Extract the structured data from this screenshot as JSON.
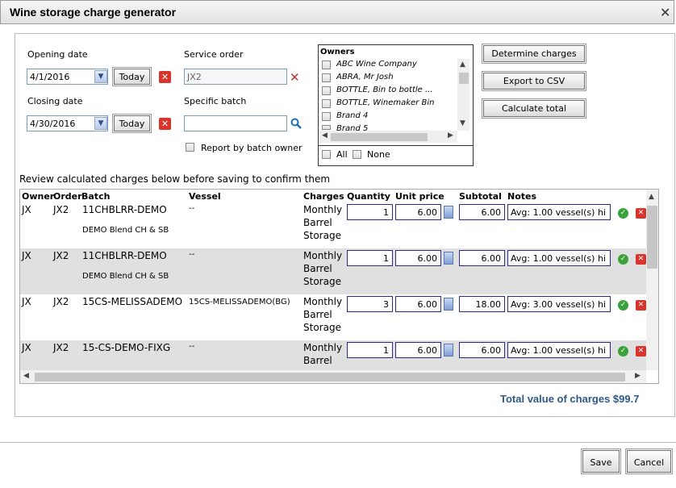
{
  "window": {
    "title": "Wine storage charge generator",
    "close": "✕"
  },
  "filters": {
    "opening_label": "Opening date",
    "opening_value": "4/1/2016",
    "closing_label": "Closing date",
    "closing_value": "4/30/2016",
    "today_label": "Today",
    "service_order_label": "Service order",
    "service_order_value": "JX2",
    "specific_batch_label": "Specific batch",
    "specific_batch_value": "",
    "report_by_batch_owner": "Report by batch owner"
  },
  "owners": {
    "heading": "Owners",
    "items": [
      "ABC Wine Company",
      "ABRA, Mr Josh",
      "BOTTLE, Bin to bottle ...",
      "BOTTLE, Winemaker Bin",
      "Brand 4",
      "Brand 5"
    ],
    "all_label": "All",
    "none_label": "None"
  },
  "actions": {
    "determine": "Determine charges",
    "export": "Export to CSV",
    "calculate": "Calculate total"
  },
  "review_text": "Review calculated charges below before saving to confirm them",
  "table": {
    "headers": [
      "Owner",
      "Order",
      "Batch",
      "Vessel",
      "Charges",
      "Quantity",
      "Unit price",
      "Subtotal",
      "Notes"
    ],
    "rows": [
      {
        "owner": "JX",
        "order": "JX2",
        "batch": "11CHBLRR-DEMO",
        "batch_desc": "DEMO Blend CH & SB",
        "vessel": "--",
        "charge1": "Monthly",
        "charge2": "Barrel",
        "charge3": "Storage",
        "quantity": "1",
        "unit_price": "6.00",
        "subtotal": "6.00",
        "notes": "Avg: 1.00 vessel(s) hi"
      },
      {
        "owner": "JX",
        "order": "JX2",
        "batch": "11CHBLRR-DEMO",
        "batch_desc": "DEMO Blend CH & SB",
        "vessel": "--",
        "charge1": "Monthly",
        "charge2": "Barrel",
        "charge3": "Storage",
        "quantity": "1",
        "unit_price": "6.00",
        "subtotal": "6.00",
        "notes": "Avg: 1.00 vessel(s) hi"
      },
      {
        "owner": "JX",
        "order": "JX2",
        "batch": "15CS-MELISSADEMO",
        "batch_desc": "",
        "vessel": "15CS-MELISSADEMO(BG)",
        "charge1": "Monthly",
        "charge2": "Barrel",
        "charge3": "Storage",
        "quantity": "3",
        "unit_price": "6.00",
        "subtotal": "18.00",
        "notes": "Avg: 3.00 vessel(s) hi"
      },
      {
        "owner": "JX",
        "order": "JX2",
        "batch": "15-CS-DEMO-FIXG",
        "batch_desc": "",
        "vessel": "--",
        "charge1": "Monthly",
        "charge2": "Barrel",
        "charge3": "",
        "quantity": "1",
        "unit_price": "6.00",
        "subtotal": "6.00",
        "notes": "Avg: 1.00 vessel(s) hi"
      }
    ]
  },
  "total_text": "Total value of charges $99.7",
  "footer": {
    "save": "Save",
    "cancel": "Cancel"
  }
}
